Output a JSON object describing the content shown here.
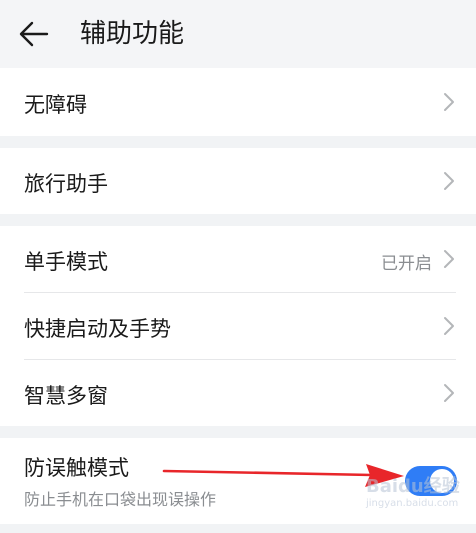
{
  "header": {
    "title": "辅助功能",
    "back_icon": "arrow-left-icon"
  },
  "groups": [
    {
      "items": [
        {
          "label": "无障碍",
          "value": ""
        }
      ]
    },
    {
      "items": [
        {
          "label": "旅行助手",
          "value": ""
        }
      ]
    },
    {
      "items": [
        {
          "label": "单手模式",
          "value": "已开启"
        },
        {
          "label": "快捷启动及手势",
          "value": ""
        },
        {
          "label": "智慧多窗",
          "value": ""
        }
      ]
    },
    {
      "items": [
        {
          "label": "防误触模式",
          "description": "防止手机在口袋出现误操作",
          "toggle_on": true
        }
      ]
    }
  ],
  "annotation": {
    "arrow_color": "#e8262a"
  },
  "watermark": {
    "text": "Baidu经验",
    "sub": "jingyan.baidu.com"
  },
  "colors": {
    "accent": "#2f7df6",
    "background": "#f1f3f5",
    "card": "#ffffff"
  }
}
